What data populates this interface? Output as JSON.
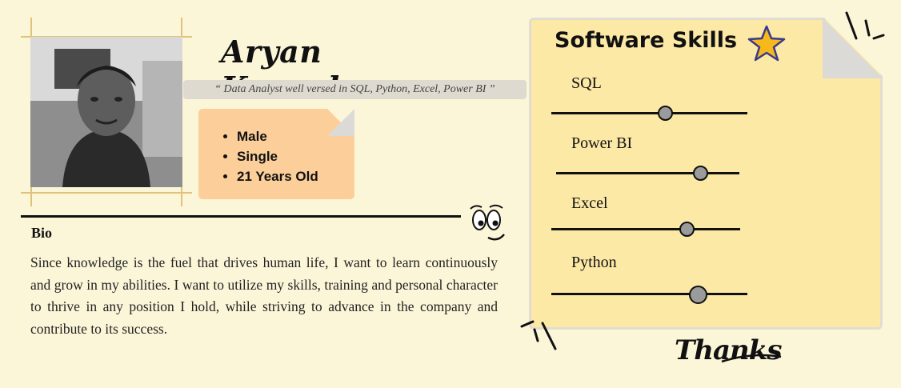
{
  "profile": {
    "name": "Aryan Kansal",
    "tagline": "“ Data Analyst well versed in SQL, Python, Excel, Power BI ”",
    "facts": [
      "Male",
      "Single",
      "21 Years Old"
    ]
  },
  "bio": {
    "title": "Bio",
    "text": "Since knowledge is the fuel that drives human life, I want to learn continuously and grow in my abilities. I want to utilize my skills, training and personal character to thrive in any position I hold, while striving to advance in the company and contribute to its success."
  },
  "skills": {
    "title": "Software Skills",
    "items": [
      {
        "label": "SQL",
        "level": 0.58
      },
      {
        "label": "Power BI",
        "level": 0.79
      },
      {
        "label": "Excel",
        "level": 0.72
      },
      {
        "label": "Python",
        "level": 0.75
      }
    ]
  },
  "footer": {
    "thanks": "Thanks"
  },
  "colors": {
    "background": "#fcf6d9",
    "card": "#fde9a6",
    "facts": "#fccf9a",
    "star": "#f6b91c",
    "frame": "#e0c27a"
  },
  "icons": [
    "star-icon",
    "smiley-face-icon",
    "person-photo"
  ]
}
